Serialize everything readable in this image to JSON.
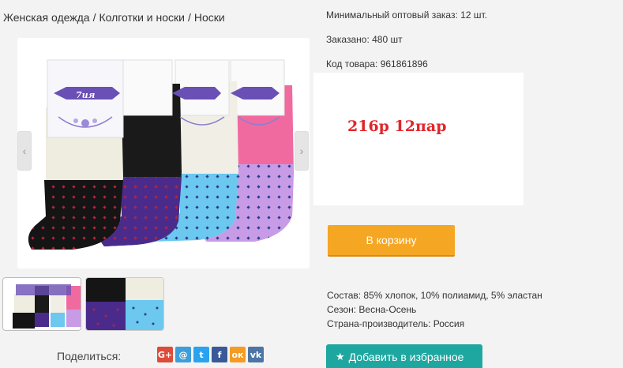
{
  "breadcrumb": {
    "items": [
      "Женская одежда",
      "Колготки и носки",
      "Носки"
    ],
    "separator": "/"
  },
  "product": {
    "min_order": "Минимальный оптовый заказ: 12 шт.",
    "ordered": "Заказано: 480 шт",
    "code": "Код товара: 961861896",
    "price_note": "216р 12пар",
    "brand_on_pack": "7ия"
  },
  "buttons": {
    "cart": "В корзину",
    "favorite": "Добавить в избранное"
  },
  "specs": {
    "composition": "Состав: 85% хлопок, 10% полиамид, 5% эластан",
    "season": "Сезон: Весна-Осень",
    "country": "Страна-производитель: Россия"
  },
  "share": {
    "label": "Поделиться:",
    "networks": [
      {
        "name": "google-plus",
        "glyph": "G+",
        "color": "#dd4b39"
      },
      {
        "name": "email",
        "glyph": "@",
        "color": "#3d9ed9"
      },
      {
        "name": "twitter",
        "glyph": "t",
        "color": "#2aa3ef"
      },
      {
        "name": "facebook",
        "glyph": "f",
        "color": "#3b5998"
      },
      {
        "name": "odnoklassniki",
        "glyph": "ок",
        "color": "#f59b22"
      },
      {
        "name": "vkontakte",
        "glyph": "vk",
        "color": "#4c75a3"
      }
    ]
  },
  "colors": {
    "accent_orange": "#f5a623",
    "accent_teal": "#1ea7a0",
    "price_red": "#e0262b"
  }
}
